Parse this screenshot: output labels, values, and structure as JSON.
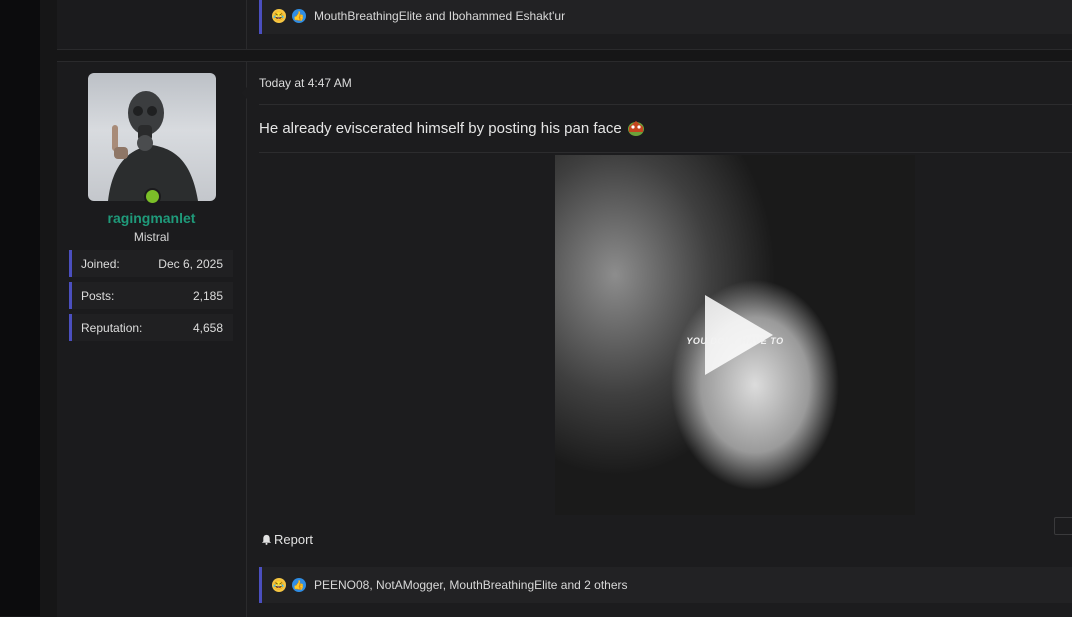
{
  "previous_post": {
    "reactions": {
      "users_text": "MouthBreathingElite and Ibohammed Eshakt'ur"
    }
  },
  "post": {
    "author": {
      "username": "ragingmanlet",
      "user_title": "Mistral",
      "online": true,
      "stats": [
        {
          "label": "Joined:",
          "value": "Dec 6, 2025"
        },
        {
          "label": "Posts:",
          "value": "2,185"
        },
        {
          "label": "Reputation:",
          "value": "4,658"
        }
      ]
    },
    "timestamp": "Today at 4:47 AM",
    "message": "He already eviscerated himself by posting his pan face",
    "video": {
      "caption": "YOU DONT HAVE TO"
    },
    "actions": {
      "report_label": "Report"
    },
    "reactions": {
      "users_text": "PEENO08, NotAMogger, MouthBreathingElite and 2 others"
    }
  },
  "icons": [
    "laugh-reaction-icon",
    "like-reaction-icon",
    "pepe-emoji-icon",
    "play-icon",
    "bell-icon"
  ],
  "colors": {
    "accent": "#4b4fbf",
    "username": "#1f9a7a",
    "online": "#7bbf28"
  }
}
